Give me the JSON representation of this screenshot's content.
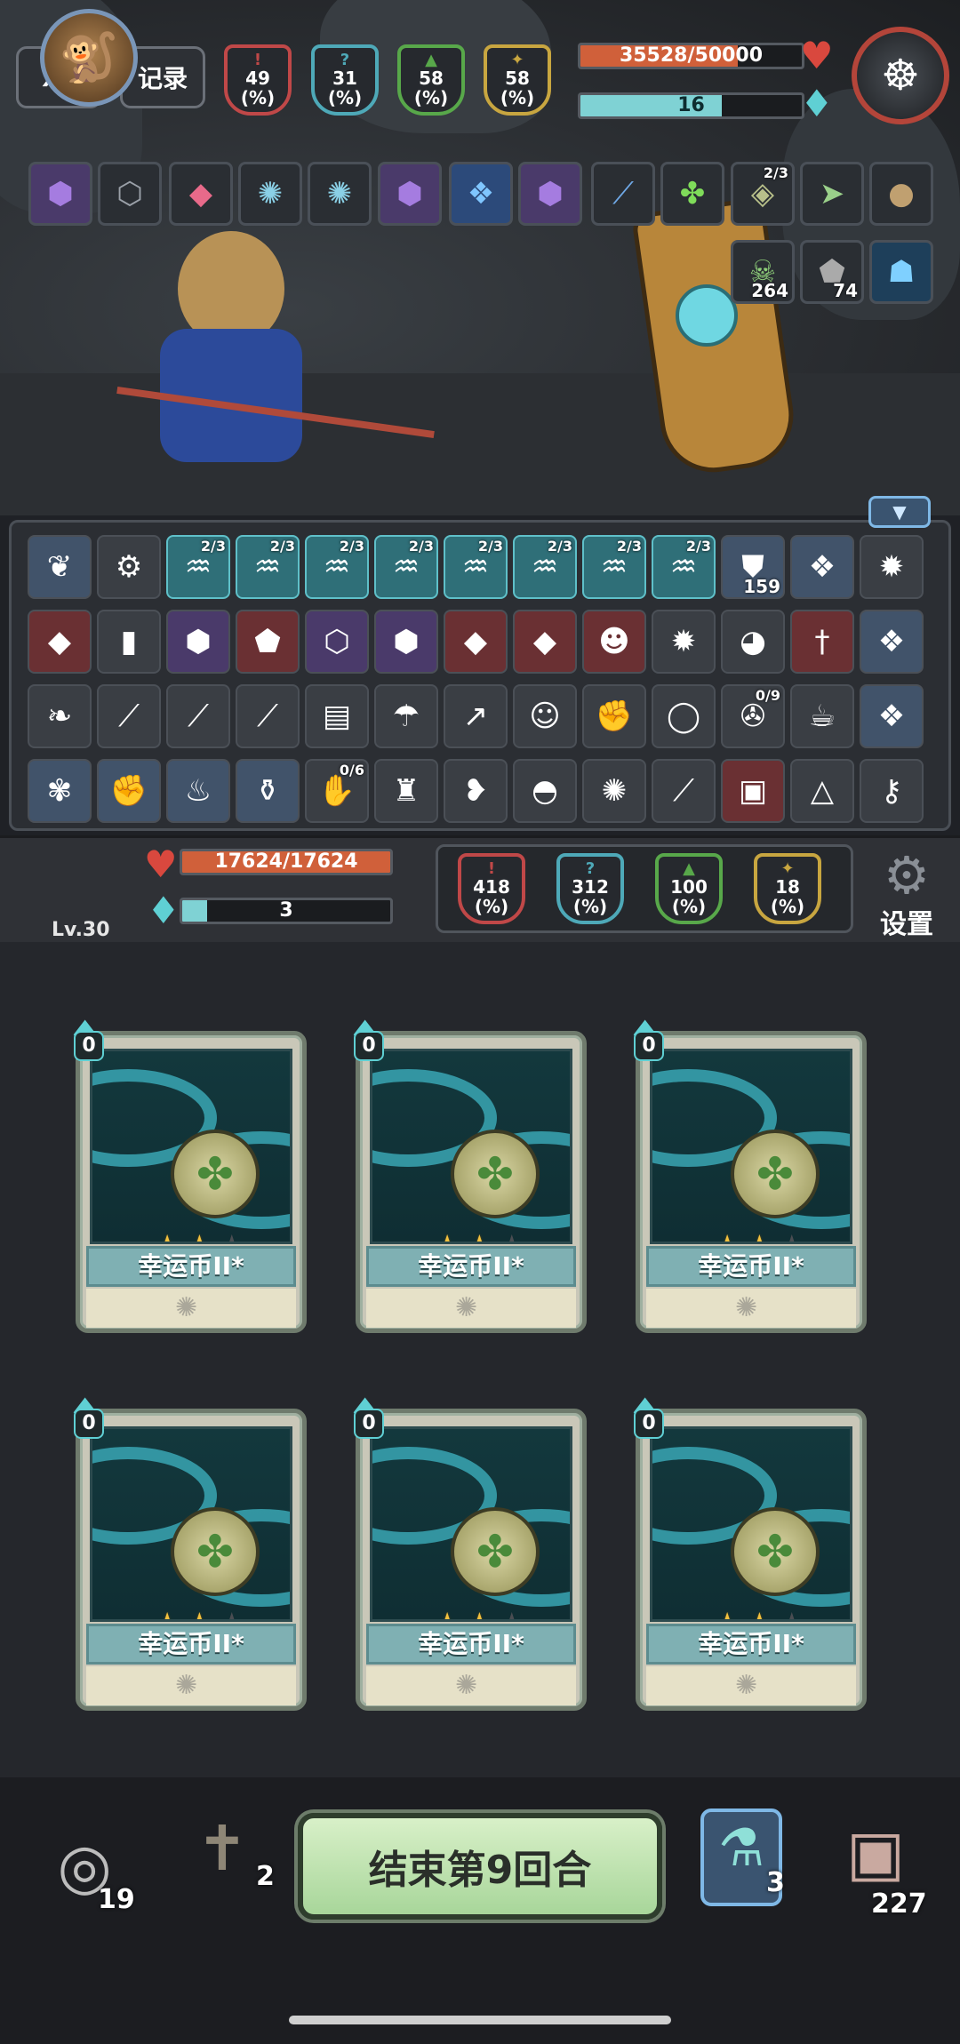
{
  "hud": {
    "speed_label": "x3",
    "record_label": "记录",
    "enemy_stats": [
      {
        "value": "49",
        "unit": "(%)",
        "color": "#c04848",
        "icon": "attack-icon"
      },
      {
        "value": "31",
        "unit": "(%)",
        "color": "#4ea9b8",
        "icon": "crit-icon"
      },
      {
        "value": "58",
        "unit": "(%)",
        "color": "#58a84a",
        "icon": "defense-icon"
      },
      {
        "value": "58",
        "unit": "(%)",
        "color": "#c8a640",
        "icon": "dodge-icon"
      }
    ]
  },
  "enemy": {
    "hp_text": "35528/50000",
    "hp_fraction": 0.71,
    "energy_text": "16",
    "energy_fraction": 0.64,
    "buff_slots": [
      {
        "icon": "blade-icon",
        "count": ""
      },
      {
        "icon": "poison-icon",
        "count": ""
      },
      {
        "icon": "crystal-icon",
        "count": "",
        "frac": "2/3"
      },
      {
        "icon": "arrow-icon",
        "count": ""
      },
      {
        "icon": "orb-icon",
        "count": ""
      },
      {
        "icon": "skull-icon",
        "count": "264"
      },
      {
        "icon": "rock-icon",
        "count": "74"
      },
      {
        "icon": "shadow-icon",
        "count": ""
      }
    ]
  },
  "player_buffs": [
    "purple-gem-icon",
    "dark-gem-icon",
    "ruby-gem-icon",
    "swirl-icon",
    "swirl-icon",
    "purple-gem-icon",
    "ice-crystal-icon",
    "purple-gem-icon"
  ],
  "relics": {
    "rows": [
      [
        {
          "icon": "feather-icon",
          "style": "slate"
        },
        {
          "icon": "gear-rune-icon",
          "style": ""
        },
        {
          "icon": "rune-icon",
          "style": "teal",
          "frac": "2/3"
        },
        {
          "icon": "rune-icon",
          "style": "teal",
          "frac": "2/3"
        },
        {
          "icon": "rune-icon",
          "style": "teal",
          "frac": "2/3"
        },
        {
          "icon": "rune-icon",
          "style": "teal",
          "frac": "2/3"
        },
        {
          "icon": "rune-icon",
          "style": "teal",
          "frac": "2/3"
        },
        {
          "icon": "rune-icon",
          "style": "teal",
          "frac": "2/3"
        },
        {
          "icon": "rune-icon",
          "style": "teal",
          "frac": "2/3"
        },
        {
          "icon": "rune-icon",
          "style": "teal",
          "frac": "2/3"
        },
        {
          "icon": "shield-icon",
          "style": "slate",
          "count": "159"
        },
        {
          "icon": "ice-crystal-icon",
          "style": "slate"
        },
        {
          "icon": "sun-icon",
          "style": ""
        }
      ],
      [
        {
          "icon": "red-gem-icon",
          "style": "red"
        },
        {
          "icon": "green-crystal-icon",
          "style": ""
        },
        {
          "icon": "purple-gem-icon",
          "style": "purple"
        },
        {
          "icon": "gold-gem-icon",
          "style": "red"
        },
        {
          "icon": "dark-gem-icon",
          "style": "purple"
        },
        {
          "icon": "purple-gem-icon",
          "style": "purple"
        },
        {
          "icon": "red-gem-icon",
          "style": "red"
        },
        {
          "icon": "red-gem-icon",
          "style": "red"
        },
        {
          "icon": "demon-icon",
          "style": "red"
        },
        {
          "icon": "sun-icon",
          "style": ""
        },
        {
          "icon": "green-stone-icon",
          "style": ""
        },
        {
          "icon": "sword-icon",
          "style": "red"
        },
        {
          "icon": "ice-crystal-icon",
          "style": "slate"
        }
      ],
      [
        {
          "icon": "gourd-icon",
          "style": ""
        },
        {
          "icon": "red-staff-icon",
          "style": ""
        },
        {
          "icon": "white-staff-icon",
          "style": ""
        },
        {
          "icon": "gold-staff-icon",
          "style": ""
        },
        {
          "icon": "book-icon",
          "style": ""
        },
        {
          "icon": "water-icon",
          "style": ""
        },
        {
          "icon": "spear-icon",
          "style": ""
        },
        {
          "icon": "bear-icon",
          "style": ""
        },
        {
          "icon": "gauntlet-icon",
          "style": ""
        },
        {
          "icon": "ring-icon",
          "style": ""
        },
        {
          "icon": "compass-icon",
          "style": "",
          "frac": "0/9"
        },
        {
          "icon": "teacup-icon",
          "style": ""
        },
        {
          "icon": "ice-crystal-icon",
          "style": "slate"
        }
      ],
      [
        {
          "icon": "chain-icon",
          "style": "slate"
        },
        {
          "icon": "fist-icon",
          "style": "slate"
        },
        {
          "icon": "flame-head-icon",
          "style": "slate"
        },
        {
          "icon": "bottle-icon",
          "style": "slate"
        },
        {
          "icon": "hand-sign-icon",
          "style": "",
          "frac": "0/6"
        },
        {
          "icon": "soldier-icon",
          "style": ""
        },
        {
          "icon": "pepper-icon",
          "style": ""
        },
        {
          "icon": "sack-icon",
          "style": ""
        },
        {
          "icon": "spiked-ball-icon",
          "style": ""
        },
        {
          "icon": "gold-staff-icon",
          "style": ""
        },
        {
          "icon": "card-box-icon",
          "style": "red"
        },
        {
          "icon": "rice-ball-icon",
          "style": ""
        },
        {
          "icon": "key-icon",
          "style": ""
        }
      ]
    ]
  },
  "player": {
    "level": "Lv.30",
    "hp_text": "17624/17624",
    "hp_fraction": 1.0,
    "energy_text": "3",
    "energy_fraction": 0.12,
    "stats": [
      {
        "value": "418",
        "unit": "(%)",
        "color": "#c04848"
      },
      {
        "value": "312",
        "unit": "(%)",
        "color": "#4ea9b8"
      },
      {
        "value": "100",
        "unit": "(%)",
        "color": "#58a84a"
      },
      {
        "value": "18",
        "unit": "(%)",
        "color": "#c8a640"
      }
    ],
    "settings_label": "设置"
  },
  "hand": {
    "cards": [
      {
        "cost": "0",
        "name": "幸运币II*",
        "stars": 2,
        "max_stars": 3
      },
      {
        "cost": "0",
        "name": "幸运币II*",
        "stars": 2,
        "max_stars": 3
      },
      {
        "cost": "0",
        "name": "幸运币II*",
        "stars": 2,
        "max_stars": 3
      },
      {
        "cost": "0",
        "name": "幸运币II*",
        "stars": 2,
        "max_stars": 3
      },
      {
        "cost": "0",
        "name": "幸运币II*",
        "stars": 2,
        "max_stars": 3
      },
      {
        "cost": "0",
        "name": "幸运币II*",
        "stars": 2,
        "max_stars": 3
      }
    ]
  },
  "bottom": {
    "discard_count": "19",
    "graveyard_count": "2",
    "end_turn_label": "结束第9回合",
    "potion_count": "3",
    "draw_count": "227"
  }
}
